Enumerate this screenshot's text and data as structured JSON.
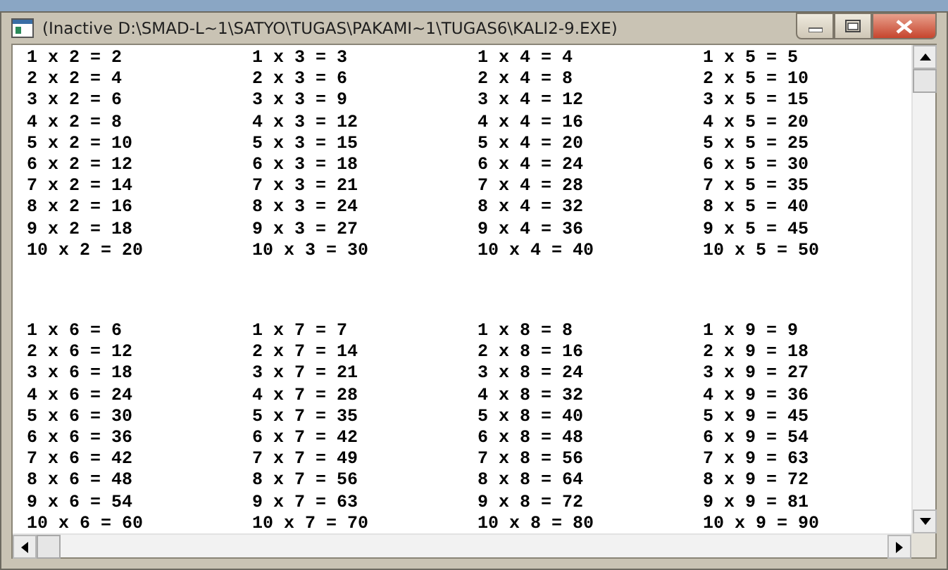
{
  "window": {
    "title": "(Inactive D:\\SMAD-L~1\\SATYO\\TUGAS\\PAKAMI~1\\TUGAS6\\KALI2-9.EXE)"
  },
  "groups": [
    {
      "tables": [
        {
          "lines": [
            "1 x 2 = 2",
            "2 x 2 = 4",
            "3 x 2 = 6",
            "4 x 2 = 8",
            "5 x 2 = 10",
            "6 x 2 = 12",
            "7 x 2 = 14",
            "8 x 2 = 16",
            "9 x 2 = 18",
            "10 x 2 = 20"
          ]
        },
        {
          "lines": [
            "1 x 3 = 3",
            "2 x 3 = 6",
            "3 x 3 = 9",
            "4 x 3 = 12",
            "5 x 3 = 15",
            "6 x 3 = 18",
            "7 x 3 = 21",
            "8 x 3 = 24",
            "9 x 3 = 27",
            "10 x 3 = 30"
          ]
        },
        {
          "lines": [
            "1 x 4 = 4",
            "2 x 4 = 8",
            "3 x 4 = 12",
            "4 x 4 = 16",
            "5 x 4 = 20",
            "6 x 4 = 24",
            "7 x 4 = 28",
            "8 x 4 = 32",
            "9 x 4 = 36",
            "10 x 4 = 40"
          ]
        },
        {
          "lines": [
            "1 x 5 = 5",
            "2 x 5 = 10",
            "3 x 5 = 15",
            "4 x 5 = 20",
            "5 x 5 = 25",
            "6 x 5 = 30",
            "7 x 5 = 35",
            "8 x 5 = 40",
            "9 x 5 = 45",
            "10 x 5 = 50"
          ]
        }
      ]
    },
    {
      "tables": [
        {
          "lines": [
            "1 x 6 = 6",
            "2 x 6 = 12",
            "3 x 6 = 18",
            "4 x 6 = 24",
            "5 x 6 = 30",
            "6 x 6 = 36",
            "7 x 6 = 42",
            "8 x 6 = 48",
            "9 x 6 = 54",
            "10 x 6 = 60"
          ]
        },
        {
          "lines": [
            "1 x 7 = 7",
            "2 x 7 = 14",
            "3 x 7 = 21",
            "4 x 7 = 28",
            "5 x 7 = 35",
            "6 x 7 = 42",
            "7 x 7 = 49",
            "8 x 7 = 56",
            "9 x 7 = 63",
            "10 x 7 = 70"
          ]
        },
        {
          "lines": [
            "1 x 8 = 8",
            "2 x 8 = 16",
            "3 x 8 = 24",
            "4 x 8 = 32",
            "5 x 8 = 40",
            "6 x 8 = 48",
            "7 x 8 = 56",
            "8 x 8 = 64",
            "9 x 8 = 72",
            "10 x 8 = 80"
          ]
        },
        {
          "lines": [
            "1 x 9 = 9",
            "2 x 9 = 18",
            "3 x 9 = 27",
            "4 x 9 = 36",
            "5 x 9 = 45",
            "6 x 9 = 54",
            "7 x 9 = 63",
            "8 x 9 = 72",
            "9 x 9 = 81",
            "10 x 9 = 90"
          ]
        }
      ]
    }
  ]
}
